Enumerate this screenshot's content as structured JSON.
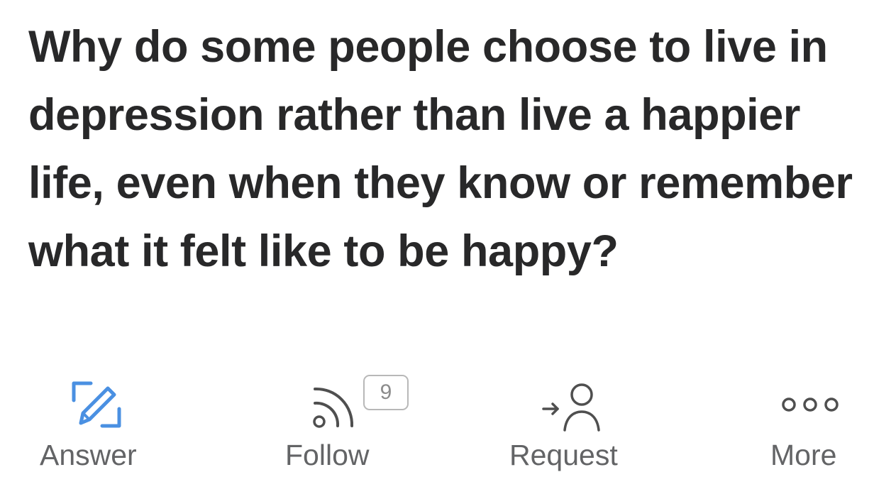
{
  "question": {
    "title": "Why do some people choose to live in depression rather than live a happier life, even when they know or remember what it felt like to be happy?"
  },
  "actions": {
    "answer": {
      "label": "Answer",
      "icon": "edit-pencil-icon",
      "color": "#4a90e2"
    },
    "follow": {
      "label": "Follow",
      "icon": "rss-feed-icon",
      "count": "9"
    },
    "request": {
      "label": "Request",
      "icon": "person-arrow-icon"
    },
    "more": {
      "label": "More",
      "icon": "more-dots-icon"
    }
  },
  "colors": {
    "text": "#282829",
    "secondary": "#636466",
    "icon_gray": "#4f4f4f",
    "accent_blue": "#4a90e2"
  }
}
